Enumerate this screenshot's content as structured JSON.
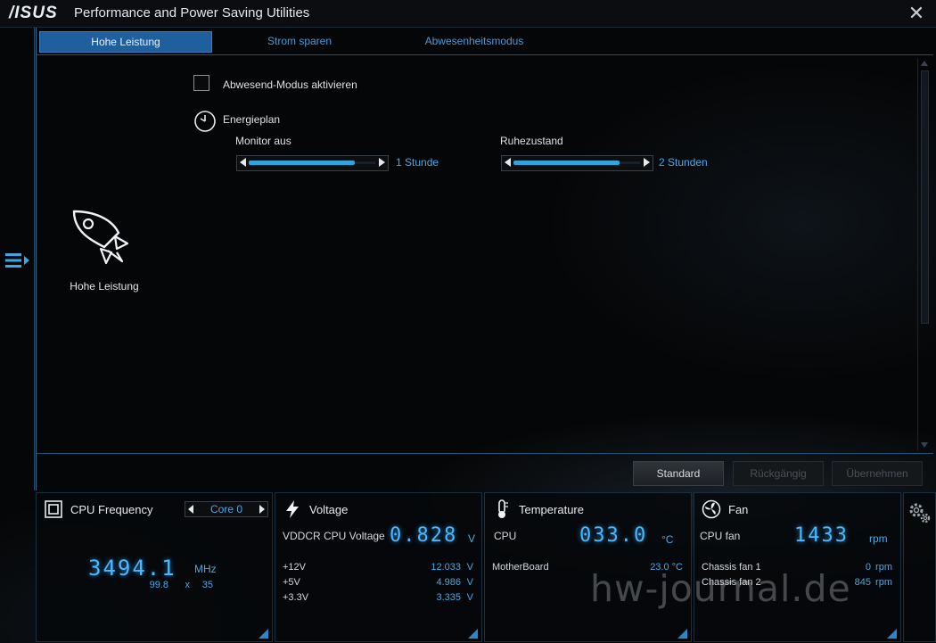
{
  "app": {
    "logo": "/ISUS",
    "title": "Performance and Power Saving Utilities",
    "close_symbol": "✕"
  },
  "tabs": [
    {
      "label": "Hohe Leistung",
      "active": true
    },
    {
      "label": "Strom sparen",
      "active": false
    },
    {
      "label": "Abwesenheitsmodus",
      "active": false
    }
  ],
  "content": {
    "away_mode_label": "Abwesend-Modus aktivieren",
    "away_mode_checked": false,
    "power_plan_label": "Energieplan",
    "monitor_off": {
      "label": "Monitor aus",
      "value": "1 Stunde",
      "level_pct": 84
    },
    "sleep": {
      "label": "Ruhezustand",
      "value": "2 Stunden",
      "level_pct": 84
    }
  },
  "mode": {
    "label": "Hohe Leistung",
    "icon": "rocket-icon"
  },
  "buttons": {
    "standard": "Standard",
    "undo": "Rückgängig",
    "apply": "Übernehmen"
  },
  "cpu": {
    "title": "CPU Frequency",
    "core": "Core 0",
    "frequency": "3494.1",
    "unit": "MHz",
    "base_clock": "99.8",
    "times": "x",
    "multiplier": "35"
  },
  "voltage": {
    "title": "Voltage",
    "main_label": "VDDCR CPU Voltage",
    "main_value": "0.828",
    "main_unit": "V",
    "rows": [
      {
        "label": "+12V",
        "value": "12.033",
        "unit": "V"
      },
      {
        "label": "+5V",
        "value": "4.986",
        "unit": "V"
      },
      {
        "label": "+3.3V",
        "value": "3.335",
        "unit": "V"
      }
    ]
  },
  "temperature": {
    "title": "Temperature",
    "main_label": "CPU",
    "main_value": "033.0",
    "main_unit": "°C",
    "rows": [
      {
        "label": "MotherBoard",
        "value": "23.0 °C"
      }
    ]
  },
  "fan": {
    "title": "Fan",
    "main_label": "CPU fan",
    "main_value": "1433",
    "main_unit": "rpm",
    "rows": [
      {
        "label": "Chassis fan 1",
        "value": "0",
        "unit": "rpm"
      },
      {
        "label": "Chassis fan 2",
        "value": "845",
        "unit": "rpm"
      }
    ]
  },
  "watermark": "hw-journal.de",
  "colors": {
    "accent": "#2ea6dc",
    "lcd": "#4ab8ff",
    "tab_active": "#1f5f9e"
  }
}
